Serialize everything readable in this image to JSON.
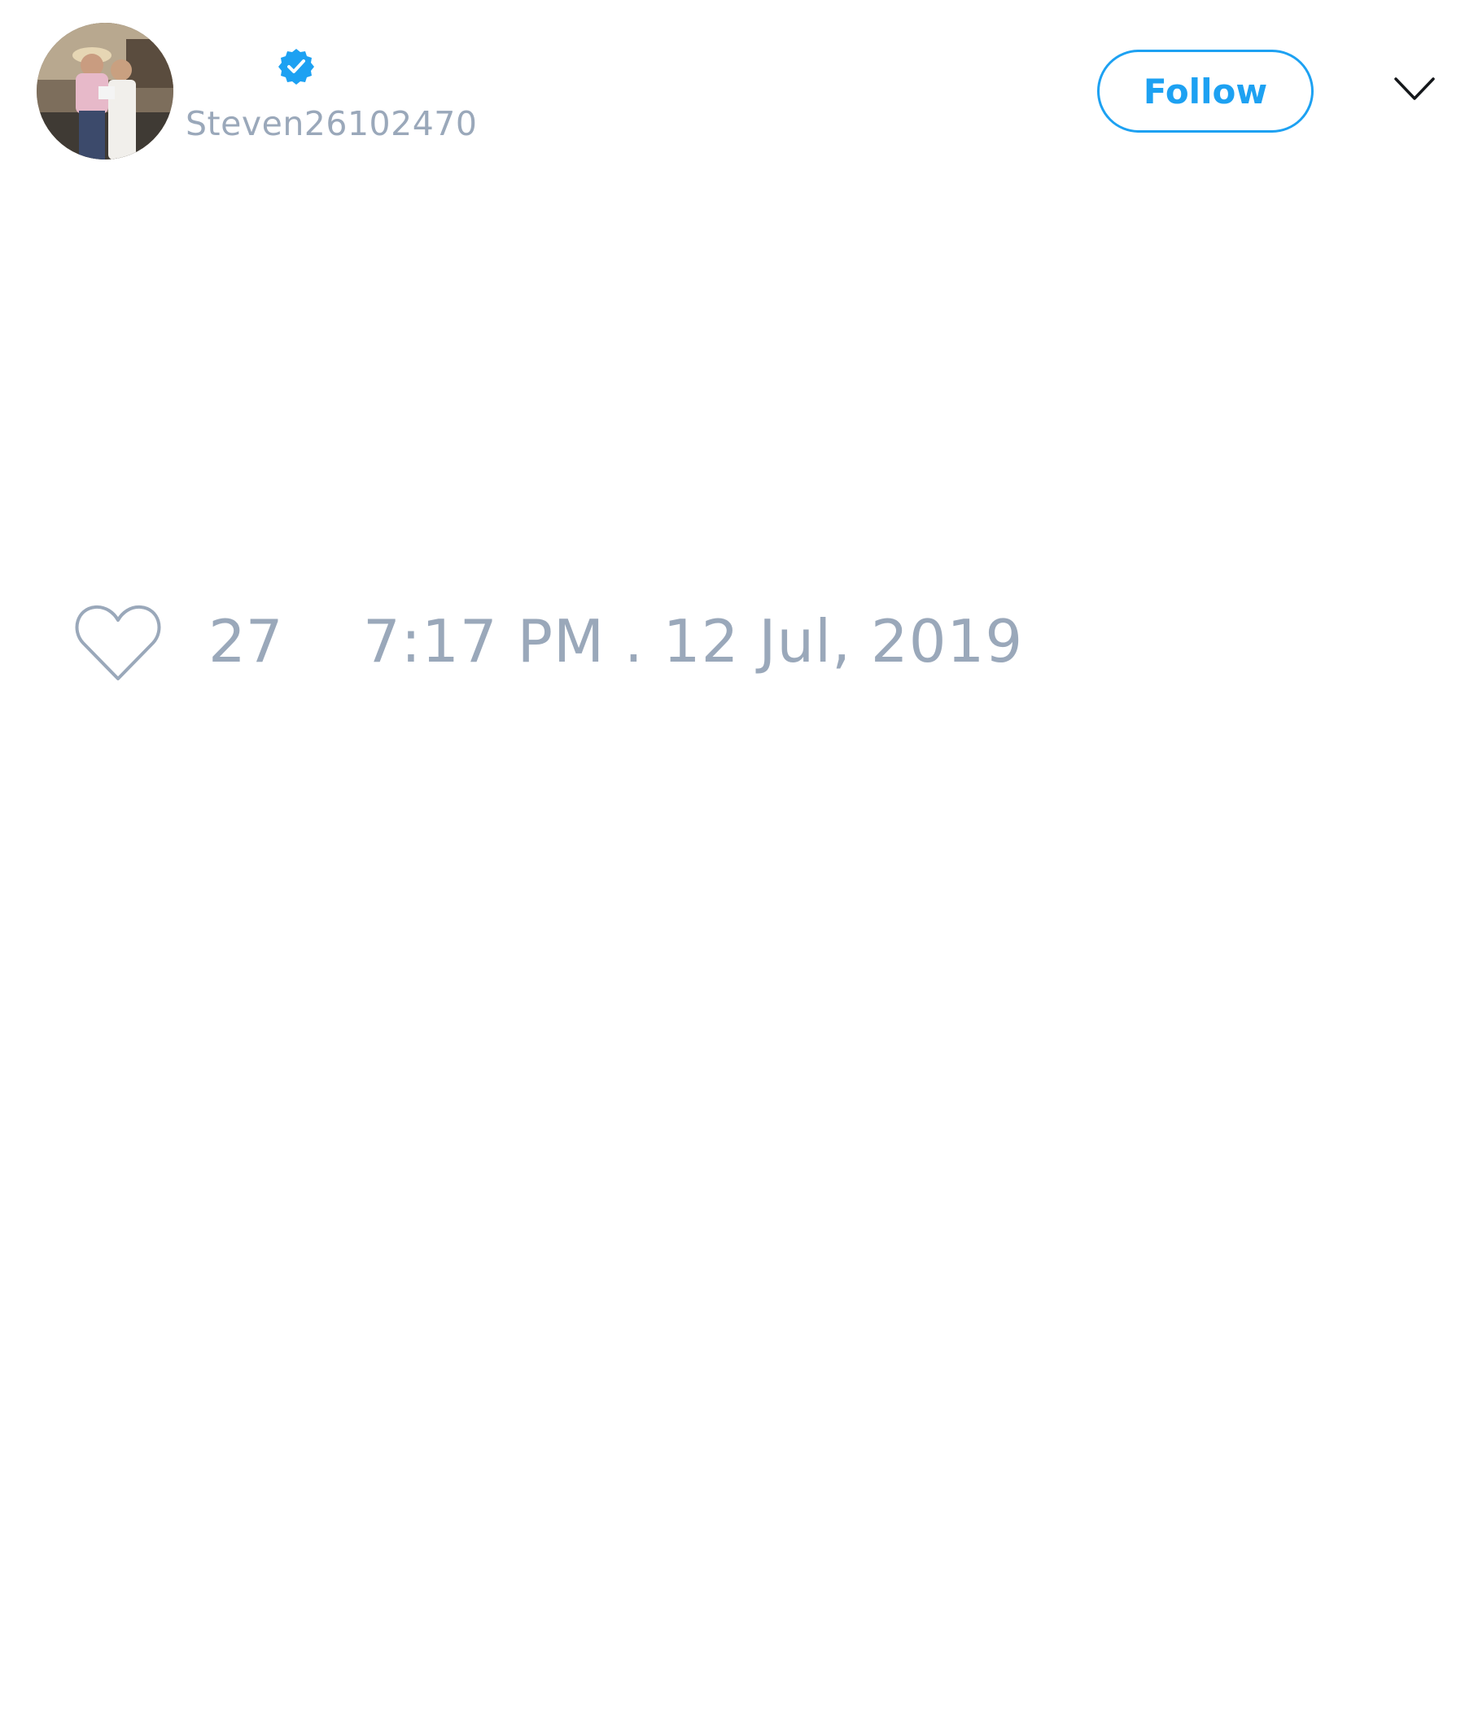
{
  "tweet": {
    "author": {
      "display_name": "",
      "username": "Steven26102470",
      "verified": true,
      "avatar_icon": "profile-photo"
    },
    "follow_label": "Follow",
    "more_icon": "chevron-down-icon",
    "like_icon": "heart-icon",
    "like_count": "27",
    "timestamp": "7:17 PM . 12 Jul, 2019"
  },
  "colors": {
    "accent": "#1da1f2",
    "muted_text": "#9aa8ba",
    "background": "#ffffff"
  }
}
